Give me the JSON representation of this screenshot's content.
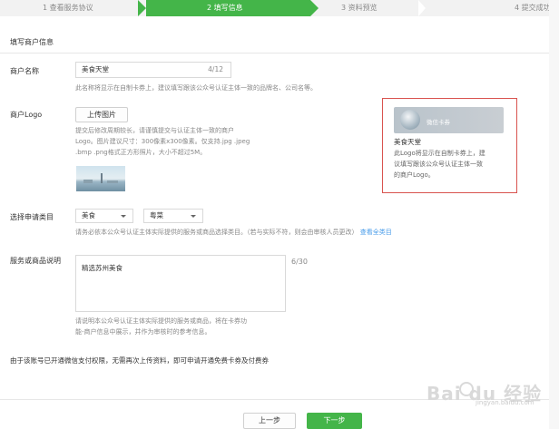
{
  "steps": [
    {
      "label": "1 查看服务协议",
      "active": false
    },
    {
      "label": "2 填写信息",
      "active": true
    },
    {
      "label": "3 资料预览",
      "active": false
    },
    {
      "label": "4 提交成功",
      "active": false
    }
  ],
  "section_title": "填写商户信息",
  "merchant_name": {
    "label": "商户名称",
    "value": "美食天堂",
    "counter": "4/12",
    "hint": "此名称将显示在自制卡券上，建议填写跟该公众号认证主体一致的品牌名、公司名等。"
  },
  "merchant_logo": {
    "label": "商户Logo",
    "upload_button": "上传图片",
    "hint_lines": [
      "提交后修改周期较长，请谨慎提交与认证主体一致的商户",
      "Logo。图片建议尺寸：300像素x300像素。仅支持.jpg .jpeg",
      ".bmp .png格式正方形照片，大小不超过5M。"
    ]
  },
  "preview": {
    "card_name": "微信卡券",
    "merchant_name": "美食天堂",
    "desc_lines": [
      "此Logo将显示在自制卡券上，建",
      "议填写跟该公众号认证主体一致",
      "的商户Logo。"
    ]
  },
  "category": {
    "label": "选择申请类目",
    "primary": "美食",
    "secondary": "粤菜",
    "hint": "请务必依本公众号认证主体实际提供的服务或商品选择类目。（若与实际不符，则会由审核人员更改）",
    "link": "查看全类目"
  },
  "description": {
    "label": "服务或商品说明",
    "value": "精选苏州美食",
    "counter": "6/30",
    "hint_lines": [
      "请说明本公众号认证主体实际提供的服务或商品，将在卡券功",
      "能-商户信息中展示，并作为审核时的参考信息。"
    ]
  },
  "notice": "由于该账号已开通微信支付权限，无需再次上传资料，即可申请开通免费卡券及付费券",
  "buttons": {
    "prev": "上一步",
    "next": "下一步"
  },
  "watermark": {
    "text": "Bai du 经验",
    "sub": "jingyan.baidu.com"
  }
}
